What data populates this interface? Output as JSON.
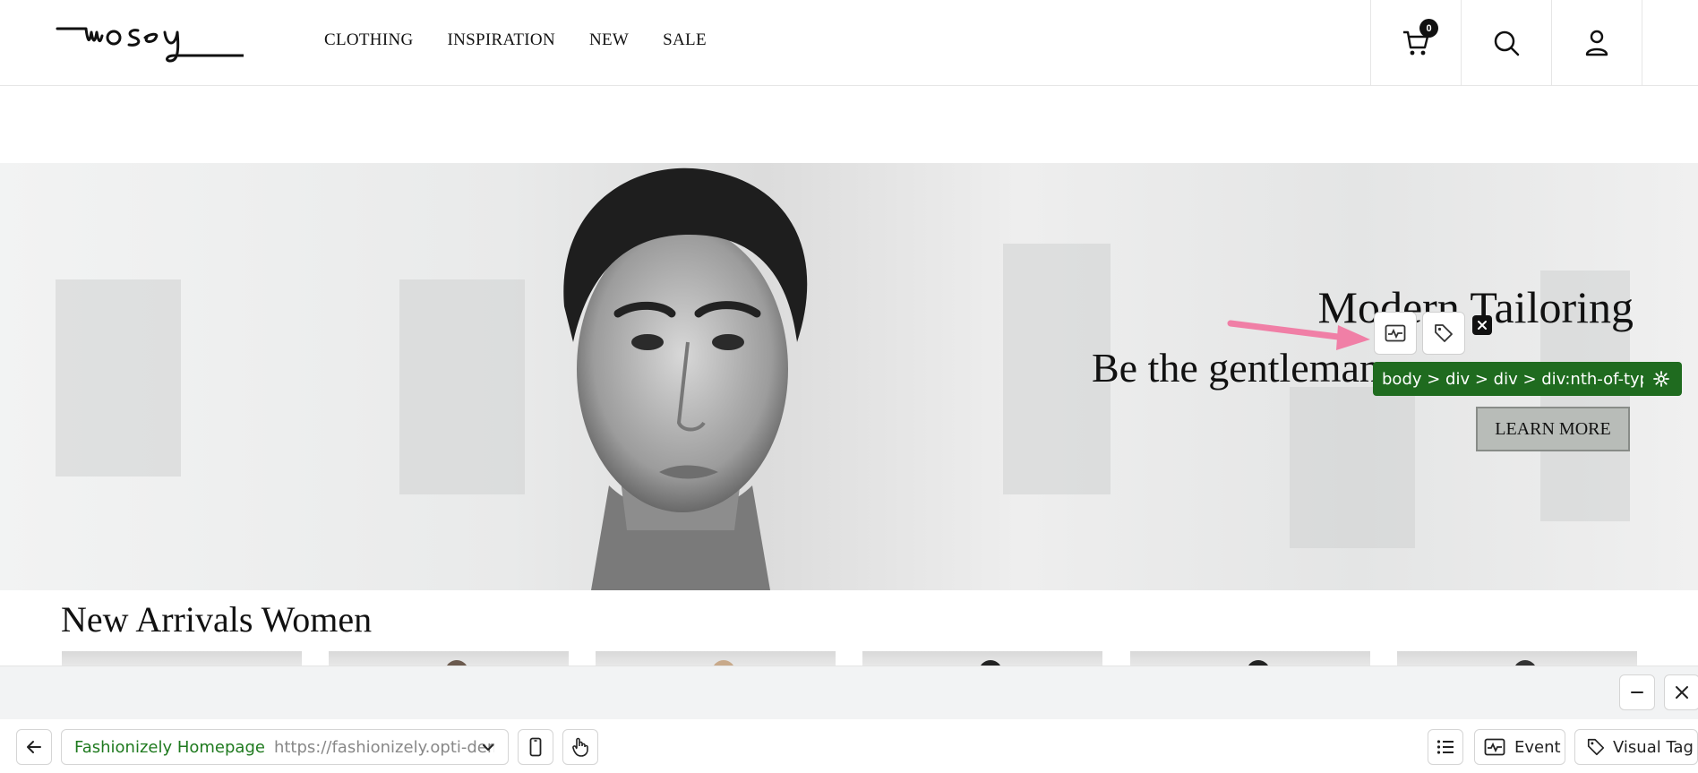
{
  "header": {
    "logo_text": "mosey",
    "nav": [
      "CLOTHING",
      "INSPIRATION",
      "NEW",
      "SALE"
    ],
    "cart_count": "0"
  },
  "hero": {
    "title": "Modern Tailoring",
    "subtitle": "Be the gentleman",
    "cta": "LEARN MORE"
  },
  "arrivals": {
    "title": "New Arrivals Women",
    "product_count": 6
  },
  "overlay": {
    "selector": "body > div > div > div:nth-of-typ..."
  },
  "toolbar": {
    "page_name": "Fashionizely Homepage",
    "page_url": "https://fashionizely.opti-demo...",
    "event_label": "Event",
    "visual_tag_label": "Visual Tag"
  },
  "colors": {
    "selector_bg": "#1f6b1f",
    "site_name": "#1f7a1f",
    "arrow": "#f07fa6",
    "learn_more_bg": "#b8bcb8"
  }
}
